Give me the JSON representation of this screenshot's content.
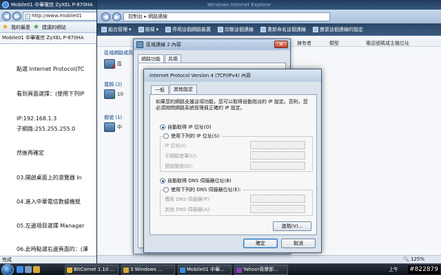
{
  "browser": {
    "title": "Mobile01 中華電信 ZyXEL P-870HA",
    "address": "http://www.mobile01",
    "fav_my": "我的最愛",
    "fav_suggested": "建議的網站",
    "tab_title": "Mobile01 中華電信 ZyXEL P-870HA",
    "lines": [
      "點選 Internet Protocol(TC",
      "看到頁面選擇：(使用下列IP",
      "IP:192.168.1.3",
      "子網路:255.255.255.0",
      "然後再確定",
      "03.開啟桌面上的瀏覽器 In",
      "04.進入中華電信數據機競",
      "05.左邊項目選擇 Manager",
      "06.此時點選右邊頁面的：(澤"
    ],
    "status": "完成"
  },
  "explorer": {
    "title": "Windows Internet Explorer",
    "breadcrumb": [
      "控制台",
      "網路連線"
    ],
    "toolbar": [
      "組合管理",
      "檢視",
      "停用這個網路裝置",
      "診斷這個連線",
      "重新命名這個連線",
      "變更這個連線的設定"
    ],
    "columns": [
      "擁有者",
      "類型",
      "電話號碼或主機位址"
    ],
    "groups": [
      "區域網路或高速",
      "寬頻 (2)",
      "撥號 (1)"
    ],
    "items": [
      "區",
      "10",
      "中"
    ],
    "status_zoom": "125%"
  },
  "lan_dialog": {
    "title": "區域連線 2 內容",
    "tabs": [
      "網路功能",
      "共用"
    ]
  },
  "tcpip": {
    "title": "Internet Protocol Version 4 (TCP/IPv4) 內容",
    "tabs": [
      "一般",
      "其他設定"
    ],
    "description": "如果您的網路支援這項功能，您可以取得自動指派的 IP 設定。否則，您必須詢問網路系統管理員正確的 IP 設定。",
    "ip_auto": "自動取得 IP 位址(O)",
    "ip_manual": "使用下列的 IP 位址(S):",
    "ip_fields": [
      "IP 位址(I):",
      "子網路遮罩(U):",
      "預設閘道(D):"
    ],
    "dns_auto": "自動取得 DNS 伺服器位址(B)",
    "dns_manual": "使用下列的 DNS 伺服器位址(E):",
    "dns_fields": [
      "慣用 DNS 伺服器(P):",
      "其他 DNS 伺服器(A):"
    ],
    "advanced_button": "進階(V)...",
    "ok_button": "確定",
    "cancel_button": "取消",
    "ip_mode": "auto",
    "dns_mode": "auto"
  },
  "taskbar": {
    "tasks": [
      "BitComet 1.10 ...",
      "3 Windows ...",
      "Mobile01 中華...",
      "Yahoo!奇摩即..."
    ],
    "clock": "上午",
    "watermark": "#822879"
  }
}
